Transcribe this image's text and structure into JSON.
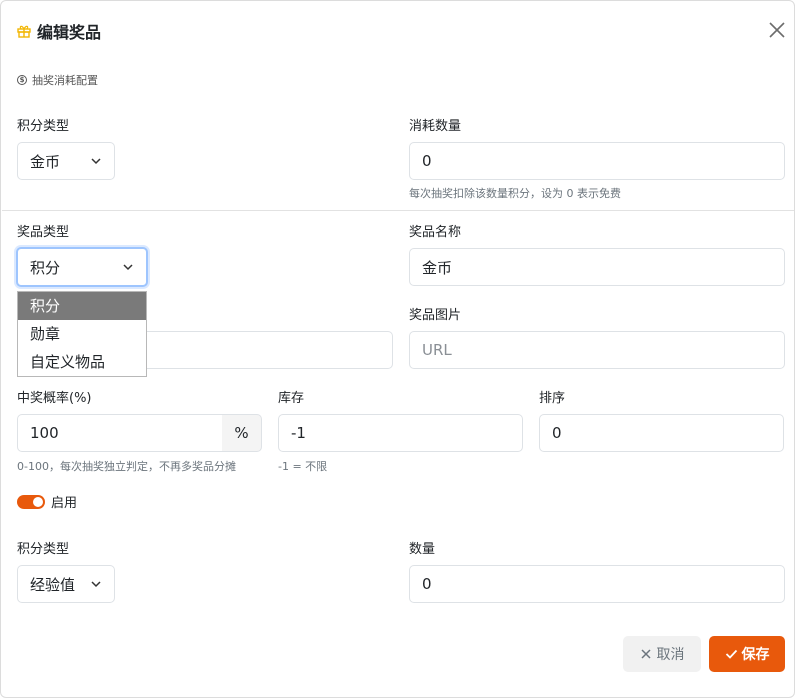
{
  "dialog": {
    "title": "编辑奖品",
    "section_label": "抽奖消耗配置"
  },
  "cost": {
    "points_type_label": "积分类型",
    "points_type_value": "金币",
    "amount_label": "消耗数量",
    "amount_value": "0",
    "amount_hint": "每次抽奖扣除该数量积分，设为 0 表示免费"
  },
  "prize": {
    "type_label": "奖品类型",
    "type_value": "积分",
    "type_options": [
      "积分",
      "勋章",
      "自定义物品"
    ],
    "name_label": "奖品名称",
    "name_value": "金币",
    "image_label": "奖品图片",
    "image_placeholder": "URL"
  },
  "probability": {
    "label": "中奖概率(%)",
    "value": "100",
    "unit": "%",
    "hint": "0-100，每次抽奖独立判定，不再多奖品分摊"
  },
  "stock": {
    "label": "库存",
    "value": "-1",
    "hint": "-1 = 不限"
  },
  "sort": {
    "label": "排序",
    "value": "0"
  },
  "enabled": {
    "label": "启用",
    "on": true
  },
  "reward": {
    "points_type_label": "积分类型",
    "points_type_value": "经验值",
    "quantity_label": "数量",
    "quantity_value": "0"
  },
  "buttons": {
    "cancel": "取消",
    "save": "保存"
  },
  "colors": {
    "accent": "#e8590c",
    "gift_icon": "#f2b705",
    "focus_ring": "#9ec5fe"
  }
}
